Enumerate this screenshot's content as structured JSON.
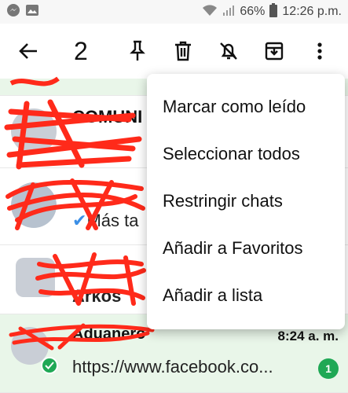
{
  "status": {
    "battery": "66%",
    "time": "12:26 p.m."
  },
  "toolbar": {
    "selected_count": "2"
  },
  "menu": {
    "items": [
      {
        "label": "Marcar como leído"
      },
      {
        "label": "Seleccionar todos"
      },
      {
        "label": "Restringir chats"
      },
      {
        "label": "Añadir a Favoritos"
      },
      {
        "label": "Añadir a lista"
      }
    ]
  },
  "chats": [
    {
      "title": "COMUNI",
      "preview": ""
    },
    {
      "title": "",
      "preview": "Más ta"
    },
    {
      "title": "",
      "preview": "Arkos"
    },
    {
      "title": "Aduanero",
      "preview": "https://www.facebook.co...",
      "time": "8:24 a. m.",
      "unread": "1"
    }
  ],
  "colors": {
    "accent": "#1fa855",
    "selected_row": "#e9f6e9",
    "scribble": "#ff2a1a"
  }
}
